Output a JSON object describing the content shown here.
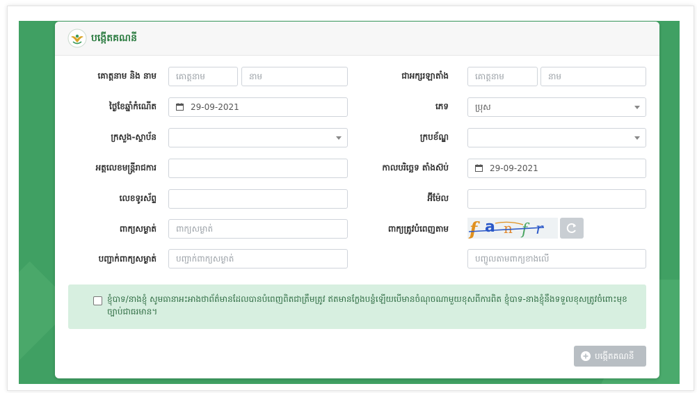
{
  "card": {
    "title": "បង្កើតគណនី"
  },
  "form": {
    "labels": {
      "name": "គោត្តនាម និង នាម",
      "name_latin": "ជាអក្សរឡាតាំង",
      "dob": "ថ្ងៃខែឆ្នាំកំណើត",
      "gender": "ភេទ",
      "ministry": "ក្រសួង-ស្ថាប័ន",
      "department": "ក្របខ័ណ្ឌ",
      "officer_id": "អត្តលេខមន្ត្រីរាជការ",
      "start_date": "កាលបរិច្ឆេទ តាំងស៊ប់",
      "phone": "លេខទូរស័ព្ទ",
      "email": "អ៊ីម៉ែល",
      "password": "ពាក្យសម្ងាត់",
      "captcha": "ពាក្យត្រូវបំពេញតាម",
      "confirm_password": "បញ្ជាក់ពាក្យសម្ងាត់"
    },
    "placeholders": {
      "surname": "គោត្តនាម",
      "given_name": "នាម",
      "surname_latin": "គោត្តនាម",
      "given_name_latin": "នាម",
      "password": "ពាក្យសម្ងាត់",
      "confirm_password": "បញ្ជាក់ពាក្យសម្ងាត់",
      "captcha": "បញ្ចូលតាមពាក្យខាងលើ"
    },
    "values": {
      "dob": "29-09-2021",
      "gender": "ប្រុស",
      "start_date": "29-09-2021"
    },
    "captcha_text": [
      "f",
      "a",
      "n",
      "f",
      "r"
    ]
  },
  "agreement": {
    "text": "ខ្ញុំបាទ/នាងខ្ញុំ សូមធានាអះអាងថាព័ត៌មានដែលបានបំពេញពិតជាត្រឹមត្រូវ ឥតមានក្លែងបន្លំឡើយបើមានចំណុចណាមួយខុសពីការពិត ខ្ញុំបាទ-នាងខ្ញុំនឹងទទួលខុសត្រូវចំពោះមុខច្បាប់ជាធរមាន។"
  },
  "buttons": {
    "submit": "បង្កើតគណនី"
  },
  "colors": {
    "background_green": "#40a063",
    "agreement_bg": "#d7efe0",
    "title_green": "#2e7d43"
  }
}
